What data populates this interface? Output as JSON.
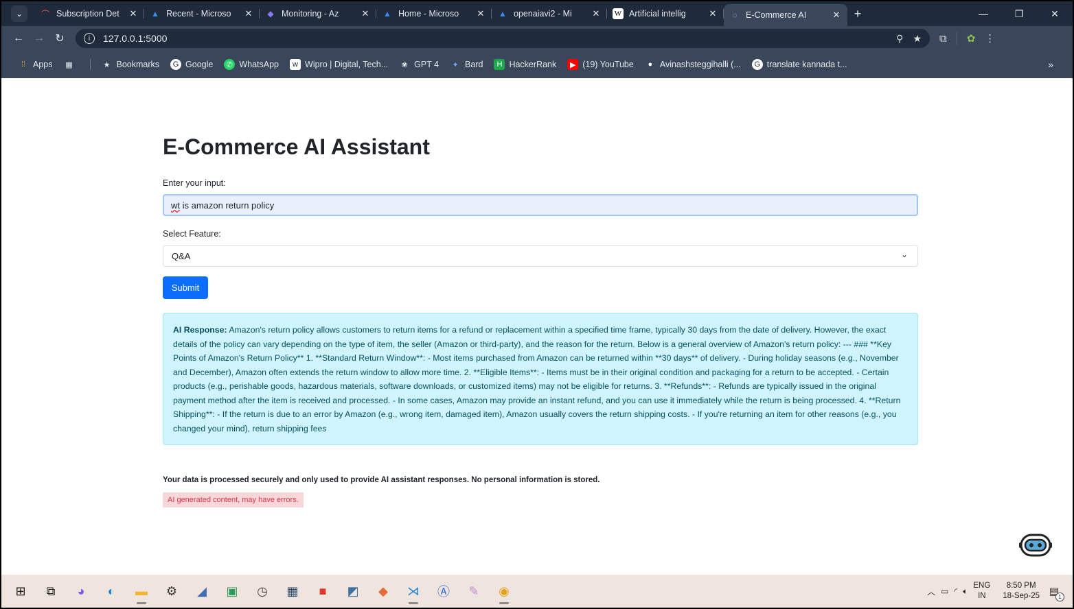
{
  "browser": {
    "tabs": [
      {
        "title": "Subscription Det",
        "icon": "azure-arc-icon",
        "glyph": "⌒",
        "color": "#e85a4f"
      },
      {
        "title": "Recent - Microso",
        "icon": "azure-icon",
        "glyph": "▲",
        "color": "#3b8cf2"
      },
      {
        "title": "Monitoring - Az",
        "icon": "azure-monitor-icon",
        "glyph": "◆",
        "color": "#8a7cf6"
      },
      {
        "title": "Home - Microso",
        "icon": "azure-icon",
        "glyph": "▲",
        "color": "#3b8cf2"
      },
      {
        "title": "openaiavi2 - Mi",
        "icon": "azure-icon",
        "glyph": "▲",
        "color": "#3b8cf2"
      },
      {
        "title": "Artificial intellig",
        "icon": "wikipedia-icon",
        "glyph": "W",
        "color": "#ffffff"
      },
      {
        "title": "E-Commerce AI",
        "icon": "loading-globe-icon",
        "glyph": "◌",
        "color": "#c8ccd3"
      }
    ],
    "new_tab": "+",
    "close_glyph": "✕",
    "url": "127.0.0.1:5000",
    "bookmarks": [
      {
        "label": "Apps",
        "icon": "apps-grid-icon"
      },
      {
        "label": "",
        "icon": "tab-groups-icon"
      },
      {
        "label": "Bookmarks",
        "icon": "star-icon"
      },
      {
        "label": "Google",
        "icon": "google-icon"
      },
      {
        "label": "WhatsApp",
        "icon": "whatsapp-icon"
      },
      {
        "label": "Wipro | Digital, Tech...",
        "icon": "wipro-icon"
      },
      {
        "label": "GPT 4",
        "icon": "openai-icon"
      },
      {
        "label": "Bard",
        "icon": "bard-sparkle-icon"
      },
      {
        "label": "HackerRank",
        "icon": "hackerrank-icon"
      },
      {
        "label": "(19) YouTube",
        "icon": "youtube-icon"
      },
      {
        "label": "Avinashsteggihalli (...",
        "icon": "github-icon"
      },
      {
        "label": "translate kannada t...",
        "icon": "google-icon"
      }
    ],
    "more": "»"
  },
  "page": {
    "title": "E-Commerce AI Assistant",
    "input_label": "Enter your input:",
    "input_value_prefix": "wt",
    "input_value_rest": " is amazon return policy",
    "select_label": "Select Feature:",
    "select_value": "Q&A",
    "submit_label": "Submit",
    "response_label": "AI Response:",
    "response_text": "Amazon's return policy allows customers to return items for a refund or replacement within a specified time frame, typically 30 days from the date of delivery. However, the exact details of the policy can vary depending on the type of item, the seller (Amazon or third-party), and the reason for the return. Below is a general overview of Amazon's return policy: --- ### **Key Points of Amazon's Return Policy** 1. **Standard Return Window**: - Most items purchased from Amazon can be returned within **30 days** of delivery. - During holiday seasons (e.g., November and December), Amazon often extends the return window to allow more time. 2. **Eligible Items**: - Items must be in their original condition and packaging for a return to be accepted. - Certain products (e.g., perishable goods, hazardous materials, software downloads, or customized items) may not be eligible for returns. 3. **Refunds**: - Refunds are typically issued in the original payment method after the item is received and processed. - In some cases, Amazon may provide an instant refund, and you can use it immediately while the return is being processed. 4. **Return Shipping**: - If the return is due to an error by Amazon (e.g., wrong item, damaged item), Amazon usually covers the return shipping costs. - If you're returning an item for other reasons (e.g., you changed your mind), return shipping fees",
    "privacy_note": "Your data is processed securely and only used to provide AI assistant responses. No personal information is stored.",
    "warning": "AI generated content, may have errors."
  },
  "taskbar": {
    "apps": [
      {
        "name": "windows-start-icon",
        "color": "#1a1a1a",
        "open": false
      },
      {
        "name": "task-view-icon",
        "color": "#1a1a1a",
        "open": false
      },
      {
        "name": "copilot-icon",
        "color": "#7a5cf0",
        "open": false
      },
      {
        "name": "edge-icon",
        "color": "#1b8ad6",
        "open": false
      },
      {
        "name": "file-explorer-icon",
        "color": "#f2b632",
        "open": true
      },
      {
        "name": "settings-icon",
        "color": "#333333",
        "open": false
      },
      {
        "name": "app-icon",
        "color": "#3f6fb5",
        "open": false
      },
      {
        "name": "project-icon",
        "color": "#2e9b5e",
        "open": false
      },
      {
        "name": "clock-app-icon",
        "color": "#444444",
        "open": false
      },
      {
        "name": "calculator-icon",
        "color": "#2f4a6d",
        "open": false
      },
      {
        "name": "office-icon",
        "color": "#e03a2f",
        "open": false
      },
      {
        "name": "python-icon",
        "color": "#3b6fa0",
        "open": false
      },
      {
        "name": "git-icon",
        "color": "#e56b3c",
        "open": false
      },
      {
        "name": "vscode-icon",
        "color": "#1f8ad2",
        "open": true
      },
      {
        "name": "app-store-icon",
        "color": "#2b6bd6",
        "open": false
      },
      {
        "name": "paint-icon",
        "color": "#c58ac9",
        "open": false
      },
      {
        "name": "chrome-icon",
        "color": "#e3a21a",
        "open": true
      }
    ],
    "lang_line1": "ENG",
    "lang_line2": "IN",
    "time": "8:50 PM",
    "date": "18-Sep-25",
    "notification_count": "1"
  }
}
